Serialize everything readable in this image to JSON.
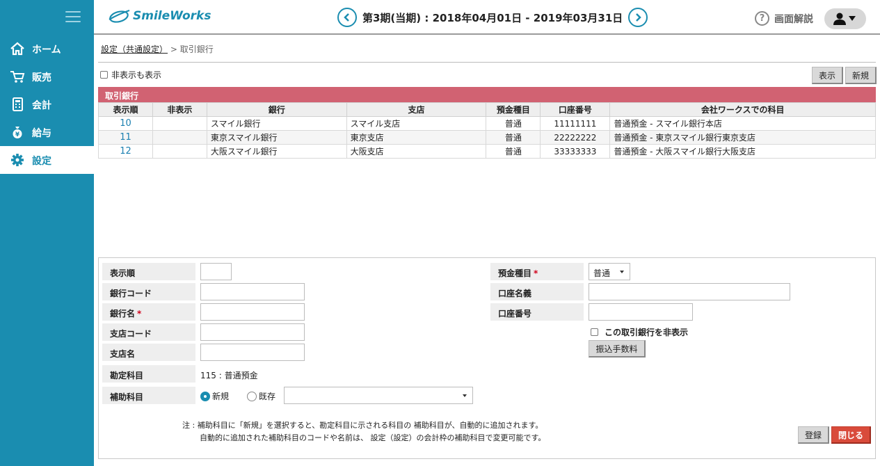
{
  "app": {
    "name": "SmileWorks"
  },
  "header": {
    "period": "第3期(当期) : 2018年04月01日 - 2019年03月31日",
    "help_label": "画面解説"
  },
  "sidebar": {
    "items": [
      {
        "label": "ホーム",
        "icon": "home-icon"
      },
      {
        "label": "販売",
        "icon": "cart-icon"
      },
      {
        "label": "会計",
        "icon": "calculator-icon"
      },
      {
        "label": "給与",
        "icon": "moneybag-icon"
      },
      {
        "label": "設定",
        "icon": "gear-icon",
        "active": true
      }
    ]
  },
  "breadcrumb": {
    "parent": "設定（共通設定）",
    "separator": ">",
    "current": "取引銀行"
  },
  "list": {
    "show_hidden_label": "非表示も表示",
    "display_button": "表示",
    "new_button": "新規",
    "section_title": "取引銀行",
    "columns": [
      "表示順",
      "非表示",
      "銀行",
      "支店",
      "預金種目",
      "口座番号",
      "会社ワークスでの科目"
    ],
    "rows": [
      {
        "order": "10",
        "hidden": "",
        "bank": "スマイル銀行",
        "branch": "スマイル支店",
        "type": "普通",
        "account": "11111111",
        "subject": "普通預金 - スマイル銀行本店"
      },
      {
        "order": "11",
        "hidden": "",
        "bank": "東京スマイル銀行",
        "branch": "東京支店",
        "type": "普通",
        "account": "22222222",
        "subject": "普通預金 - 東京スマイル銀行東京支店"
      },
      {
        "order": "12",
        "hidden": "",
        "bank": "大阪スマイル銀行",
        "branch": "大阪支店",
        "type": "普通",
        "account": "33333333",
        "subject": "普通預金 - 大阪スマイル銀行大阪支店"
      }
    ]
  },
  "form": {
    "order_label": "表示順",
    "bank_code_label": "銀行コード",
    "bank_name_label": "銀行名",
    "branch_code_label": "支店コード",
    "branch_name_label": "支店名",
    "account_subject_label": "勘定科目",
    "account_subject_value": "115 : 普通預金",
    "sub_subject_label": "補助科目",
    "radio_new": "新規",
    "radio_existing": "既存",
    "deposit_type_label": "預金種目",
    "deposit_type_value": "普通",
    "account_holder_label": "口座名義",
    "account_number_label": "口座番号",
    "hide_bank_label": "この取引銀行を非表示",
    "fee_button": "振込手数料",
    "required_mark": "*",
    "note_line1": "注 : 補助科目に「新規」を選択すると、勘定科目に示される科目の 補助科目が、自動的に追加されます。",
    "note_line2": "自動的に追加された補助科目のコードや名前は、 設定（設定）の会計枠の補助科目で変更可能です。",
    "register_button": "登録",
    "close_button": "閉じる"
  }
}
